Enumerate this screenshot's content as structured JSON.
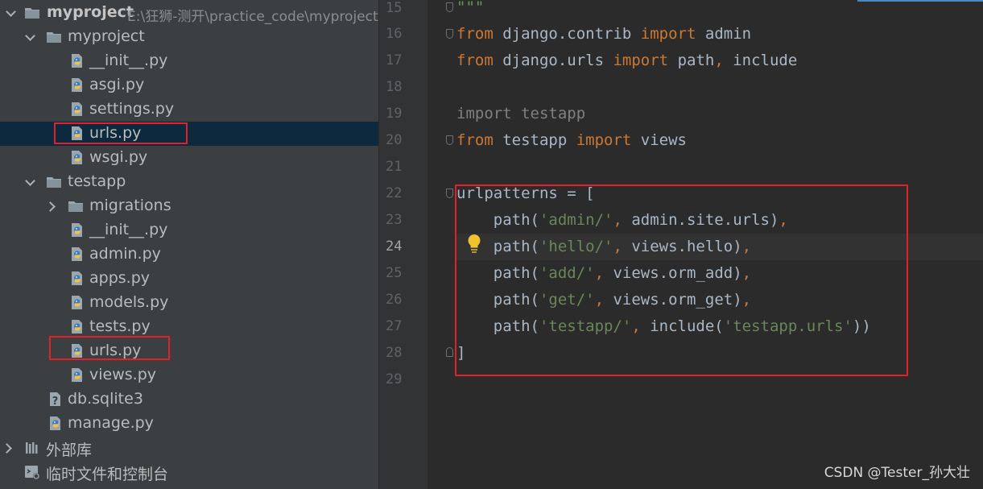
{
  "project_tree": {
    "root": {
      "name": "myproject",
      "path": "E:\\狂狮-测开\\practice_code\\myproject"
    },
    "items": [
      {
        "label": "myproject",
        "type": "folder",
        "expanded": true
      },
      {
        "label": "__init__.py",
        "type": "python-file"
      },
      {
        "label": "asgi.py",
        "type": "python-file"
      },
      {
        "label": "settings.py",
        "type": "python-file"
      },
      {
        "label": "urls.py",
        "type": "python-file",
        "selected": true
      },
      {
        "label": "wsgi.py",
        "type": "python-file"
      },
      {
        "label": "testapp",
        "type": "folder",
        "expanded": true
      },
      {
        "label": "migrations",
        "type": "folder",
        "expanded": false
      },
      {
        "label": "__init__.py",
        "type": "python-file"
      },
      {
        "label": "admin.py",
        "type": "python-file"
      },
      {
        "label": "apps.py",
        "type": "python-file"
      },
      {
        "label": "models.py",
        "type": "python-file"
      },
      {
        "label": "tests.py",
        "type": "python-file"
      },
      {
        "label": "urls.py",
        "type": "python-file"
      },
      {
        "label": "views.py",
        "type": "python-file"
      },
      {
        "label": "db.sqlite3",
        "type": "unknown-file"
      },
      {
        "label": "manage.py",
        "type": "python-file"
      }
    ],
    "external_libraries": "外部库",
    "scratches": "临时文件和控制台"
  },
  "editor": {
    "current_line": "24",
    "line_numbers": [
      "15",
      "16",
      "17",
      "18",
      "19",
      "20",
      "21",
      "22",
      "23",
      "24",
      "25",
      "26",
      "27",
      "28",
      "29"
    ],
    "code": {
      "l15": "\"\"\"",
      "l16_from": "from",
      "l16_mod": " django.contrib ",
      "l16_import": "import",
      "l16_name": " admin",
      "l17_from": "from",
      "l17_mod": " django.urls ",
      "l17_import": "import",
      "l17_name": " path",
      "l17_comma": ",",
      "l17_name2": " include",
      "l19": "import testapp",
      "l20_from": "from",
      "l20_mod": " testapp ",
      "l20_import": "import",
      "l20_name": " views",
      "l22": "urlpatterns = [",
      "l23_a": "    path(",
      "l23_s": "'admin/'",
      "l23_c": ",",
      "l23_b": " admin.site.urls)",
      "l23_e": ",",
      "l24_a": "    path(",
      "l24_s": "'hello/'",
      "l24_c": ",",
      "l24_b": " views.hello)",
      "l24_e": ",",
      "l25_a": "    path(",
      "l25_s": "'add/'",
      "l25_c": ",",
      "l25_b": " views.orm_add)",
      "l25_e": ",",
      "l26_a": "    path(",
      "l26_s": "'get/'",
      "l26_c": ",",
      "l26_b": " views.orm_get)",
      "l26_e": ",",
      "l27_a": "    path(",
      "l27_s": "'testapp/'",
      "l27_c": ",",
      "l27_b": " include(",
      "l27_s2": "'testapp.urls'",
      "l27_e": "))",
      "l28": "]"
    }
  },
  "watermark": "CSDN @Tester_孙大壮",
  "colors": {
    "keyword": "#cc7832",
    "string": "#6a8759",
    "highlight_box": "#e0202a",
    "selection": "#0d293e"
  },
  "icons": {
    "folder": "folder-icon",
    "python": "python-file-icon",
    "unknown": "unknown-file-icon",
    "library": "library-icon",
    "scratch": "scratch-icon",
    "bulb": "lightbulb-icon"
  }
}
